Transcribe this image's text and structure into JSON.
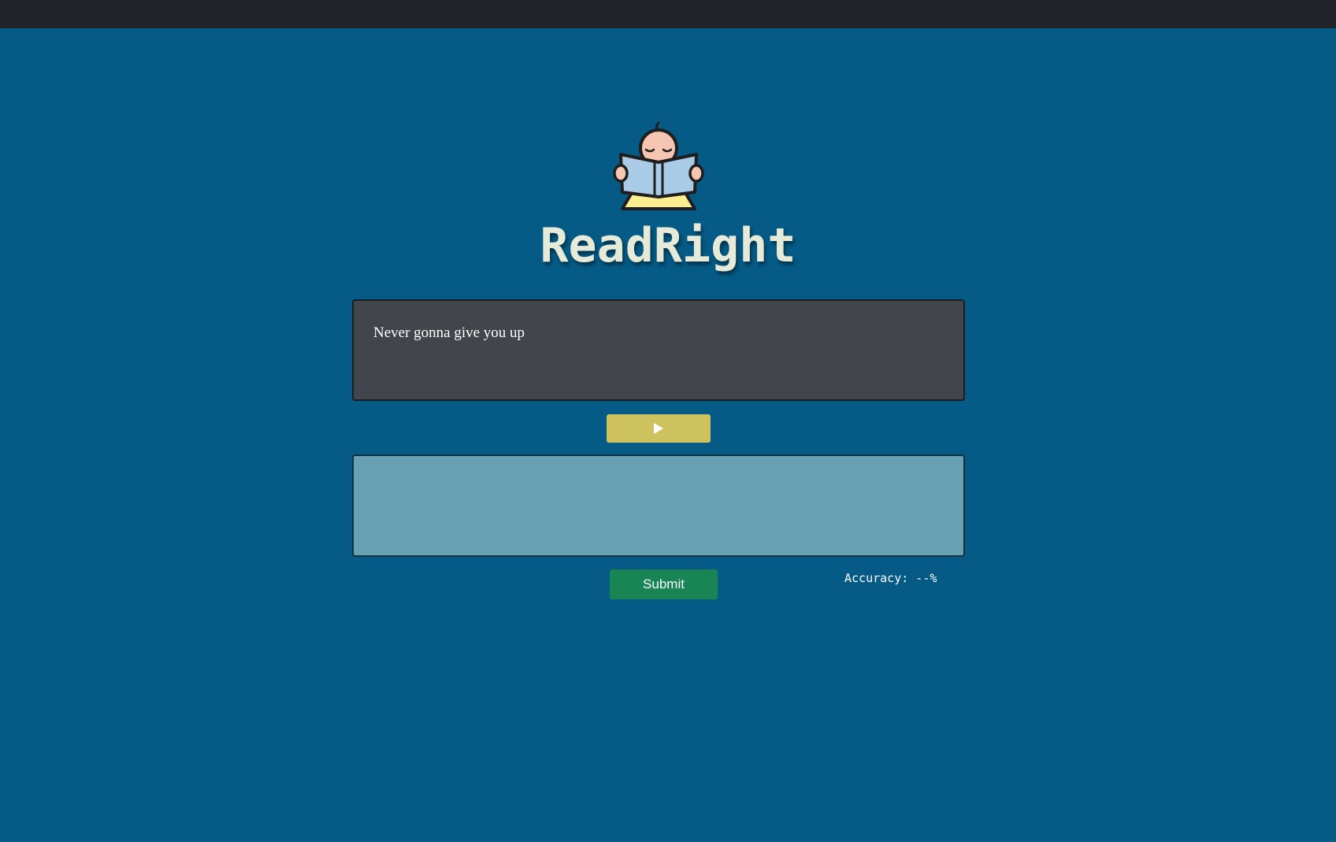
{
  "app": {
    "title": "ReadRight",
    "logo_icon": "child-reading-book-icon"
  },
  "prompt": {
    "text": "Never gonna give you up"
  },
  "controls": {
    "play_icon": "play-icon",
    "submit_label": "Submit"
  },
  "answer": {
    "value": "",
    "placeholder": ""
  },
  "stats": {
    "accuracy_label": "Accuracy: --%"
  },
  "colors": {
    "background": "#055b86",
    "topbar": "#202329",
    "prompt_box": "#43454c",
    "answer_box": "#66a0b2",
    "play_button": "#cdc25e",
    "submit_button": "#198555",
    "title_text": "#e6ead9"
  }
}
